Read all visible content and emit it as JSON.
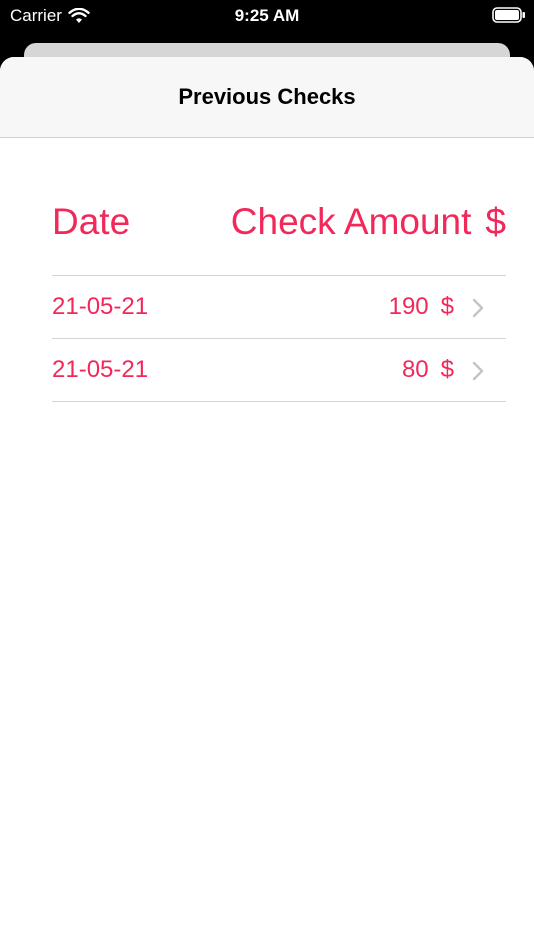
{
  "status_bar": {
    "carrier": "Carrier",
    "time": "9:25 AM"
  },
  "nav": {
    "title": "Previous Checks"
  },
  "table_header": {
    "date_label": "Date",
    "amount_label": "Check Amount",
    "currency_symbol": "$"
  },
  "checks": [
    {
      "date": "21-05-21",
      "amount": "190",
      "currency": "$"
    },
    {
      "date": "21-05-21",
      "amount": "80",
      "currency": "$"
    }
  ],
  "colors": {
    "accent": "#f2285a",
    "nav_background": "#f7f7f7",
    "separator": "#d4d4d8"
  },
  "icons": {
    "wifi": "wifi-icon",
    "battery": "battery-icon",
    "row_disclosure": "chevron-right-icon"
  }
}
